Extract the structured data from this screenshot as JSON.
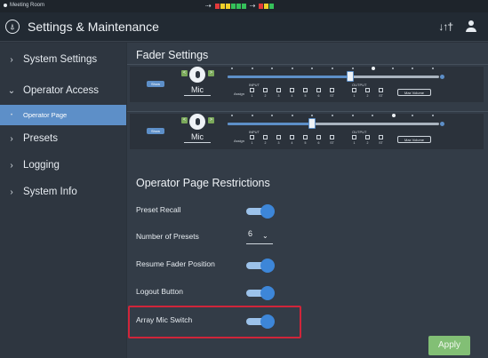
{
  "statusbar": {
    "room_name": "Meeting Room",
    "input_icon": "input-level-icon",
    "output_icon": "output-level-icon"
  },
  "header": {
    "title": "Settings & Maintenance",
    "logo_icon": "audio-technica-logo",
    "mixer_icon": "mixer-icon",
    "user_icon": "user-icon"
  },
  "sidebar": {
    "items": [
      {
        "label": "System Settings",
        "chevron": "›",
        "expanded": false
      },
      {
        "label": "Operator Access",
        "chevron": "⌄",
        "expanded": true
      },
      {
        "label": "Operator Page",
        "chevron": "•",
        "selected": true
      },
      {
        "label": "Presets",
        "chevron": "›",
        "expanded": false
      },
      {
        "label": "Logging",
        "chevron": "›",
        "expanded": false
      },
      {
        "label": "System Info",
        "chevron": "›",
        "expanded": false
      }
    ]
  },
  "fader_settings": {
    "title": "Fader Settings",
    "faders": [
      {
        "show_label": "Show",
        "prev": "<",
        "next": ">",
        "name": "Mic",
        "level": 0.58,
        "assign_label": "Assign",
        "input_label": "INPUT",
        "output_label": "OUTPUT",
        "inputs": [
          "1",
          "2",
          "3",
          "4",
          "5",
          "6",
          "ST"
        ],
        "outputs": [
          "1",
          "2",
          "ST"
        ],
        "max_volume_label": "Max Volume"
      },
      {
        "show_label": "Show",
        "prev": "<",
        "next": ">",
        "name": "Mic",
        "level": 0.4,
        "assign_label": "Assign",
        "input_label": "INPUT",
        "output_label": "OUTPUT",
        "inputs": [
          "1",
          "2",
          "3",
          "4",
          "5",
          "6",
          "ST"
        ],
        "outputs": [
          "1",
          "2",
          "ST"
        ],
        "max_volume_label": "Max Volume"
      }
    ]
  },
  "restrictions": {
    "title": "Operator Page Restrictions",
    "preset_recall": {
      "label": "Preset Recall",
      "on": true
    },
    "number_of_presets": {
      "label": "Number of Presets",
      "value": "6",
      "caret": "⌄"
    },
    "resume_fader": {
      "label": "Resume Fader Position",
      "on": true
    },
    "logout_button": {
      "label": "Logout Button",
      "on": true
    },
    "array_mic_switch": {
      "label": "Array Mic Switch",
      "on": true
    }
  },
  "apply_label": "Apply",
  "colors": {
    "accent": "#5d8fc8",
    "toggle_on": "#3d86d8",
    "apply": "#82bf75",
    "highlight": "#d0253a"
  }
}
